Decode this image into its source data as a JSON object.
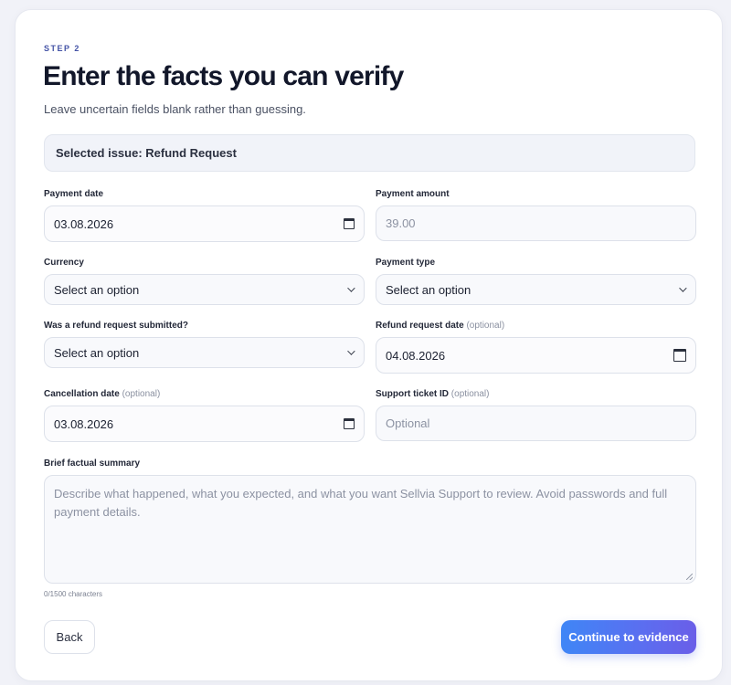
{
  "header": {
    "step": "STEP 2",
    "title": "Enter the facts you can verify",
    "subtitle": "Leave uncertain fields blank rather than guessing."
  },
  "issue": {
    "text": "Selected issue: Refund Request"
  },
  "fields": {
    "payment_date": {
      "label": "Payment date",
      "value": "03.08.2026"
    },
    "payment_amount": {
      "label": "Payment amount",
      "placeholder": "39.00"
    },
    "currency": {
      "label": "Currency",
      "value": "Select an option"
    },
    "payment_type": {
      "label": "Payment type",
      "value": "Select an option"
    },
    "refund_submitted": {
      "label": "Was a refund request submitted?",
      "value": "Select an option"
    },
    "refund_date": {
      "label": "Refund request date",
      "optional": "(optional)",
      "value": "04.08.2026"
    },
    "cancellation_date": {
      "label": "Cancellation date",
      "optional": "(optional)",
      "value": "03.08.2026"
    },
    "ticket_id": {
      "label": "Support ticket ID",
      "optional": "(optional)",
      "placeholder": "Optional"
    },
    "summary": {
      "label": "Brief factual summary",
      "placeholder": "Describe what happened, what you expected, and what you want Sellvia Support to review. Avoid passwords and full payment details.",
      "counter": "0/1500 characters"
    }
  },
  "actions": {
    "back": "Back",
    "continue": "Continue to evidence"
  },
  "icons": {
    "date": "calendar-icon",
    "select": "chevron-down-icon"
  },
  "colors": {
    "accent_start": "#3f86f6",
    "accent_end": "#6a5ee8",
    "step_label": "#4453a6"
  }
}
